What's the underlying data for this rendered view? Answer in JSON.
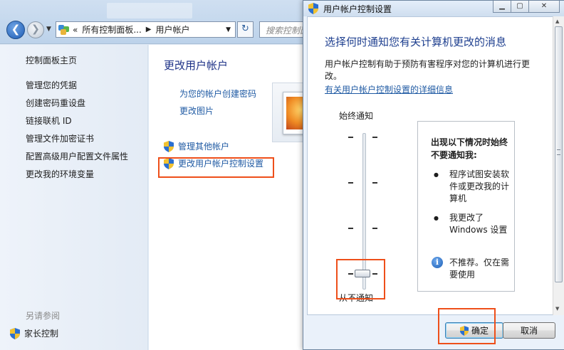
{
  "nav": {
    "back_glyph": "❮",
    "forward_glyph": "❯",
    "breadcrumb_prefix": "«",
    "breadcrumb": [
      "所有控制面板...",
      "用户帐户"
    ],
    "search_placeholder": "搜索控制面板"
  },
  "sidebar": {
    "home": "控制面板主页",
    "items": [
      "管理您的凭据",
      "创建密码重设盘",
      "链接联机 ID",
      "管理文件加密证书",
      "配置高级用户配置文件属性",
      "更改我的环境变量"
    ],
    "see_also": "另请参阅",
    "parental_control": "家长控制"
  },
  "main": {
    "title": "更改用户帐户",
    "links": [
      "为您的帐户创建密码",
      "更改图片"
    ],
    "manage_other": "管理其他帐户",
    "uac_settings": "更改用户帐户控制设置"
  },
  "uac": {
    "window_title": "用户帐户控制设置",
    "heading": "选择何时通知您有关计算机更改的消息",
    "description": "用户帐户控制有助于预防有害程序对您的计算机进行更改。",
    "details_link": "有关用户帐户控制设置的详细信息",
    "slider_top": "始终通知",
    "slider_bottom": "从不通知",
    "slider_level": 0,
    "slider_levels": 4,
    "panel_heading": "出现以下情况时始终不要通知我:",
    "bullets": [
      "程序试图安装软件或更改我的计算机",
      "我更改了 Windows 设置"
    ],
    "info_text": "不推荐。仅在需要使用",
    "ok": "确定",
    "cancel": "取消"
  },
  "colors": {
    "highlight": "#ee4f1a",
    "link": "#1f5aa3",
    "heading": "#1e3f8f"
  }
}
